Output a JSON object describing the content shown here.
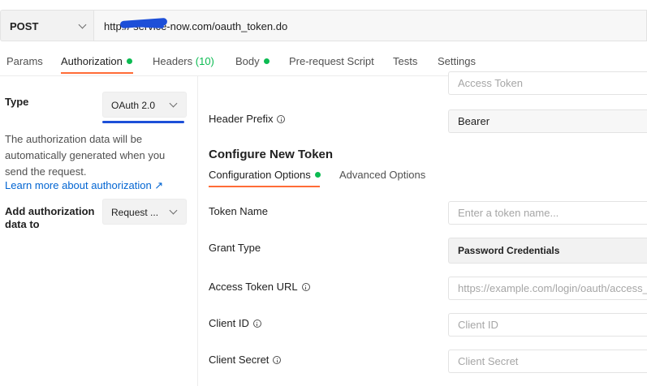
{
  "request": {
    "method": "POST",
    "url": "http://                  service-now.com/oauth_token.do"
  },
  "tabs": [
    {
      "label": "Params"
    },
    {
      "label": "Authorization"
    },
    {
      "label": "Headers",
      "count": "(10)"
    },
    {
      "label": "Body"
    },
    {
      "label": "Pre-request Script"
    },
    {
      "label": "Tests"
    },
    {
      "label": "Settings"
    }
  ],
  "auth": {
    "type_label": "Type",
    "type_value": "OAuth 2.0",
    "description": "The authorization data will be automatically generated when you send the request.",
    "learn_more": "Learn more about authorization ↗",
    "add_to_label": "Add authorization data to",
    "add_to_value": "Request ..."
  },
  "oauth": {
    "access_token_placeholder": "Access Token",
    "header_prefix_label": "Header Prefix",
    "header_prefix_value": "Bearer",
    "configure_title": "Configure New Token",
    "subtabs": [
      {
        "label": "Configuration Options"
      },
      {
        "label": "Advanced Options"
      }
    ],
    "token_name_label": "Token Name",
    "token_name_placeholder": "Enter a token name...",
    "grant_type_label": "Grant Type",
    "grant_type_value": "Password Credentials",
    "access_token_url_label": "Access Token URL",
    "access_token_url_placeholder": "https://example.com/login/oauth/access_token",
    "client_id_label": "Client ID",
    "client_id_placeholder": "Client ID",
    "client_secret_label": "Client Secret",
    "client_secret_placeholder": "Client Secret"
  },
  "colors": {
    "accent_orange": "#ff6c37",
    "status_green": "#0cbb52",
    "link_blue": "#0265d2",
    "redaction_blue": "#1d4fd8"
  }
}
